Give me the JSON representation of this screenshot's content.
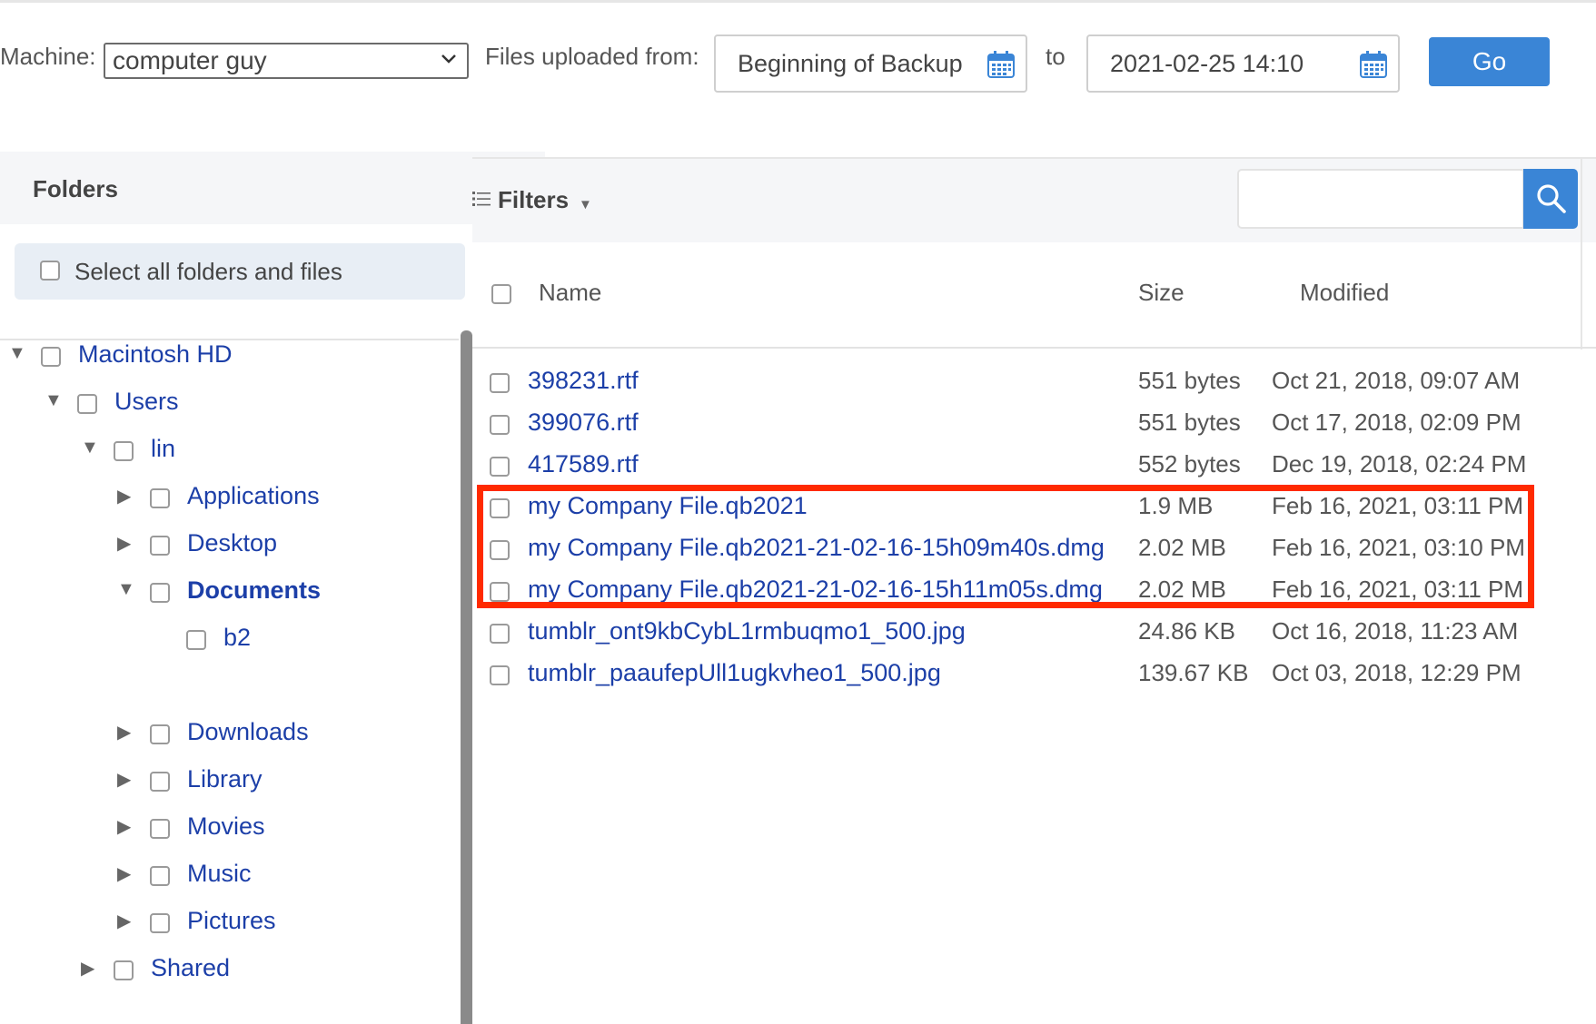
{
  "toolbar": {
    "machine_label": "Machine:",
    "machine_value": "computer guy",
    "files_from_label": "Files uploaded from:",
    "from_value": "Beginning of Backup",
    "to_label": "to",
    "to_value": "2021-02-25 14:10",
    "go_label": "Go"
  },
  "folders": {
    "title": "Folders",
    "select_all_label": "Select all folders and files",
    "tree": [
      {
        "label": "Macintosh HD",
        "expanded": true
      },
      {
        "label": "Users",
        "expanded": true
      },
      {
        "label": "lin",
        "expanded": true
      },
      {
        "label": "Applications",
        "expanded": false
      },
      {
        "label": "Desktop",
        "expanded": false
      },
      {
        "label": "Documents",
        "expanded": true,
        "selected": true
      },
      {
        "label": "b2"
      },
      {
        "label": "Downloads",
        "expanded": false
      },
      {
        "label": "Library",
        "expanded": false
      },
      {
        "label": "Movies",
        "expanded": false
      },
      {
        "label": "Music",
        "expanded": false
      },
      {
        "label": "Pictures",
        "expanded": false
      },
      {
        "label": "Shared",
        "expanded": false
      }
    ]
  },
  "files": {
    "filters_label": "Filters",
    "search_placeholder": "",
    "columns": {
      "name": "Name",
      "size": "Size",
      "modified": "Modified"
    },
    "rows": [
      {
        "name": "398231.rtf",
        "size": "551 bytes",
        "modified": "Oct 21, 2018, 09:07 AM"
      },
      {
        "name": "399076.rtf",
        "size": "551 bytes",
        "modified": "Oct 17, 2018, 02:09 PM"
      },
      {
        "name": "417589.rtf",
        "size": "552 bytes",
        "modified": "Dec 19, 2018, 02:24 PM"
      },
      {
        "name": "my Company File.qb2021",
        "size": "1.9 MB",
        "modified": "Feb 16, 2021, 03:11 PM"
      },
      {
        "name": "my Company File.qb2021-21-02-16-15h09m40s.dmg",
        "size": "2.02 MB",
        "modified": "Feb 16, 2021, 03:10 PM"
      },
      {
        "name": "my Company File.qb2021-21-02-16-15h11m05s.dmg",
        "size": "2.02 MB",
        "modified": "Feb 16, 2021, 03:11 PM"
      },
      {
        "name": "tumblr_ont9kbCybL1rmbuqmo1_500.jpg",
        "size": "24.86 KB",
        "modified": "Oct 16, 2018, 11:23 AM"
      },
      {
        "name": "tumblr_paaufepUll1ugkvheo1_500.jpg",
        "size": "139.67 KB",
        "modified": "Oct 03, 2018, 12:29 PM"
      }
    ]
  },
  "colors": {
    "accent": "#3a85d6",
    "link": "#1c3fa8",
    "highlight": "#ff2a00"
  }
}
